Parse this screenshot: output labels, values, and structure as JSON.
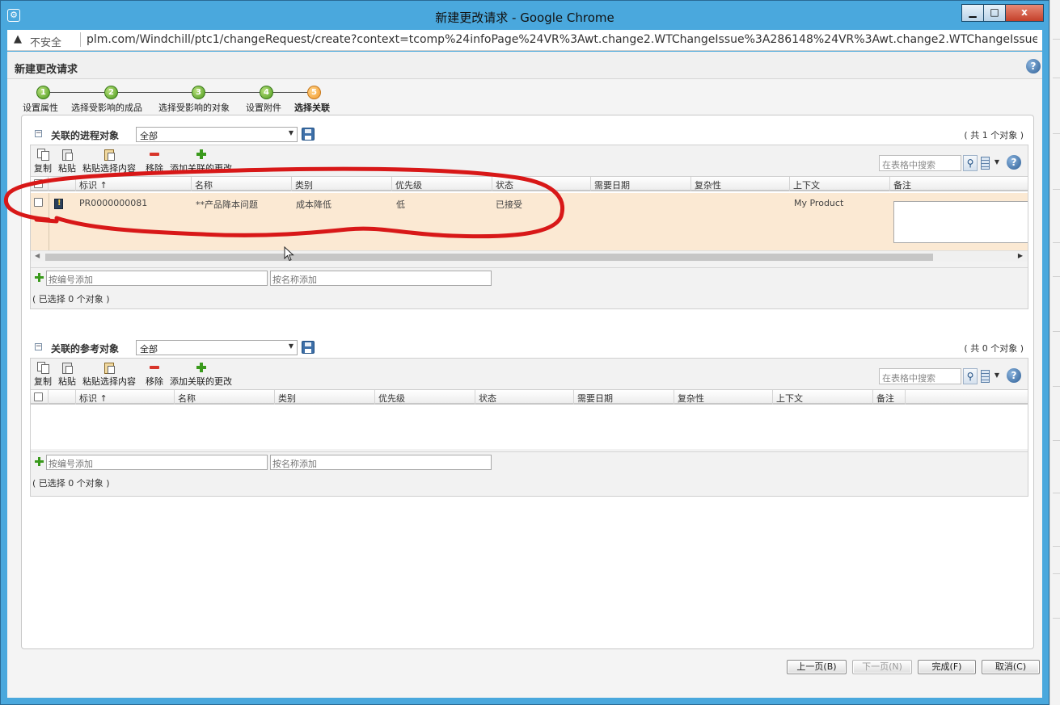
{
  "window": {
    "title": "新建更改请求 - Google Chrome",
    "minimize": "▁",
    "maximize": "□",
    "close": "x",
    "icon": "gear-icon"
  },
  "address": {
    "warning_icon": "▲",
    "insecure_label": "不安全",
    "url": "plm.com/Windchill/ptc1/changeRequest/create?context=tcomp%24infoPage%24VR%3Awt.change2.WTChangeIssue%3A286148%24VR%3Awt.change2.WTChangeIssue%3A..."
  },
  "page": {
    "title": "新建更改请求",
    "help": "?"
  },
  "wizard": {
    "steps": [
      {
        "num": "1",
        "label": "设置属性"
      },
      {
        "num": "2",
        "label": "选择受影响的成品"
      },
      {
        "num": "3",
        "label": "选择受影响的对象"
      },
      {
        "num": "4",
        "label": "设置附件"
      },
      {
        "num": "5",
        "label": "选择关联"
      }
    ],
    "current": "5"
  },
  "toolbar_labels": {
    "copy": "复制",
    "paste": "粘贴",
    "paste_selection": "粘贴选择内容",
    "remove": "移除",
    "add_change": "添加关联的更改",
    "search_placeholder": "在表格中搜索",
    "help": "?"
  },
  "columns": [
    "标识 ↑",
    "名称",
    "类别",
    "优先级",
    "状态",
    "需要日期",
    "复杂性",
    "上下文",
    "备注"
  ],
  "process_section": {
    "title": "关联的进程对象",
    "filter": "全部",
    "count": "( 共 1 个对象 )",
    "rows": [
      {
        "id": "PR0000000081",
        "name": "**产品降本问题",
        "category": "成本降低",
        "priority": "低",
        "status": "已接受",
        "need_date": "",
        "complexity": "",
        "context": "My Product",
        "note": ""
      }
    ],
    "add_by_number": "按编号添加",
    "add_by_name": "按名称添加",
    "selected": "( 已选择 0 个对象 )"
  },
  "reference_section": {
    "title": "关联的参考对象",
    "filter": "全部",
    "count": "( 共 0 个对象 )",
    "add_by_number": "按编号添加",
    "add_by_name": "按名称添加",
    "selected": "( 已选择 0 个对象 )"
  },
  "footer": {
    "prev": "上一页(B)",
    "next": "下一页(N)",
    "finish": "完成(F)",
    "cancel": "取消(C)"
  },
  "colors": {
    "titlebar": "#4aa8dd",
    "row_highlight": "#fbe9d3",
    "annotation": "#d81818"
  }
}
